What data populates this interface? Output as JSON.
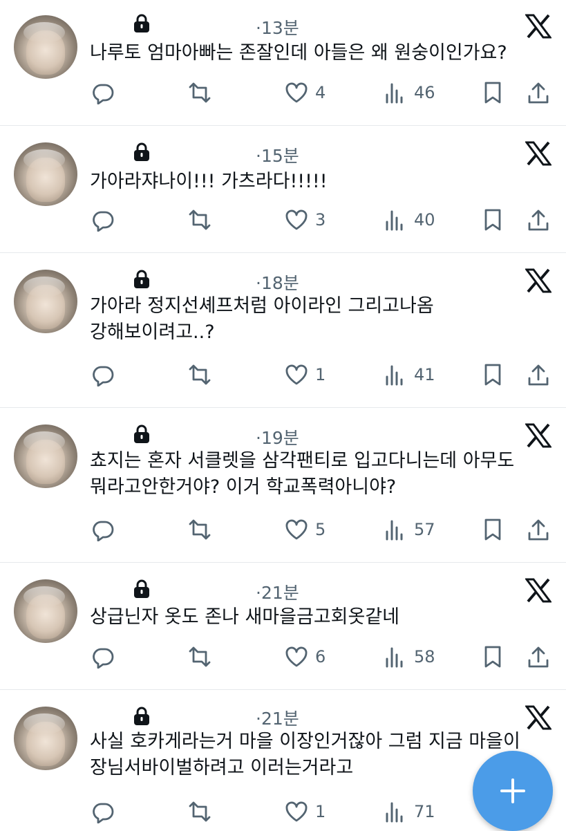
{
  "icons": {
    "lock": "lock-icon",
    "x_logo": "x-logo-icon",
    "reply": "reply-icon",
    "retweet": "retweet-icon",
    "like": "heart-icon",
    "views": "views-icon",
    "bookmark": "bookmark-icon",
    "share": "share-icon",
    "compose": "plus-icon"
  },
  "colors": {
    "text": "#0f1419",
    "secondary": "#536471",
    "fab": "#4b9ce8",
    "divider": "#e6e9ec"
  },
  "tweets": [
    {
      "time": "·13분",
      "lines": [
        "나루토 엄마아빠는 존잘인데 아들은 왜 원숭이인가요?"
      ],
      "likes": "4",
      "views": "46"
    },
    {
      "time": "·15분",
      "lines": [
        "가아라쟈나이!!! 가츠라다!!!!!"
      ],
      "likes": "3",
      "views": "40"
    },
    {
      "time": "·18분",
      "lines": [
        "가아라 정지선셰프처럼 아이라인 그리고나옴",
        "강해보이려고..?"
      ],
      "likes": "1",
      "views": "41"
    },
    {
      "time": "·19분",
      "lines": [
        "쵸지는 혼자 서클렛을 삼각팬티로 입고다니는데 아무도",
        "뭐라고안한거야? 이거 학교폭력아니야?"
      ],
      "likes": "5",
      "views": "57"
    },
    {
      "time": "·21분",
      "lines": [
        "상급닌자 옷도 존나 새마을금고회옷같네"
      ],
      "likes": "6",
      "views": "58"
    },
    {
      "time": "·21분",
      "lines": [
        "사실 호카게라는거 마을 이장인거잖아 그럼 지금 마을이",
        "장님서바이벌하려고 이러는거라고"
      ],
      "likes": "1",
      "views": "71"
    }
  ]
}
